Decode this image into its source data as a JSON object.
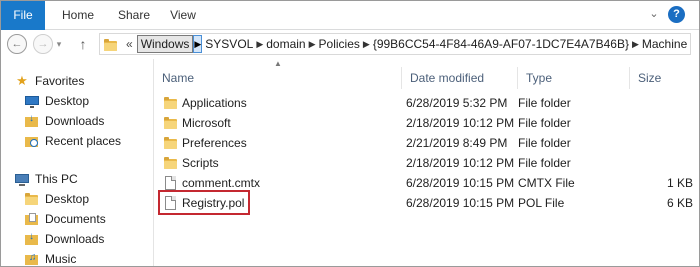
{
  "ribbon": {
    "tabs": [
      "File",
      "Home",
      "Share",
      "View"
    ],
    "expand_icon": "chevron-down-icon",
    "help_glyph": "?"
  },
  "address_bar": {
    "overflow": "«",
    "breadcrumbs": [
      "Windows",
      "SYSVOL",
      "domain",
      "Policies",
      "{99B6CC54-4F84-46A9-AF07-1DC7E4A7B46B}",
      "Machine"
    ]
  },
  "navigation": {
    "favorites_label": "Favorites",
    "favorites": [
      "Desktop",
      "Downloads",
      "Recent places"
    ],
    "this_pc_label": "This PC",
    "this_pc": [
      "Desktop",
      "Documents",
      "Downloads",
      "Music"
    ]
  },
  "file_list": {
    "columns": [
      "Name",
      "Date modified",
      "Type",
      "Size"
    ],
    "rows": [
      {
        "name": "Applications",
        "date": "6/28/2019 5:32 PM",
        "type": "File folder",
        "size": "",
        "icon": "folder-icon"
      },
      {
        "name": "Microsoft",
        "date": "2/18/2019 10:12 PM",
        "type": "File folder",
        "size": "",
        "icon": "folder-icon"
      },
      {
        "name": "Preferences",
        "date": "2/21/2019 8:49 PM",
        "type": "File folder",
        "size": "",
        "icon": "folder-icon"
      },
      {
        "name": "Scripts",
        "date": "2/18/2019 10:12 PM",
        "type": "File folder",
        "size": "",
        "icon": "folder-icon"
      },
      {
        "name": "comment.cmtx",
        "date": "6/28/2019 10:15 PM",
        "type": "CMTX File",
        "size": "1 KB",
        "icon": "file-icon"
      },
      {
        "name": "Registry.pol",
        "date": "6/28/2019 10:15 PM",
        "type": "POL File",
        "size": "6 KB",
        "icon": "file-icon",
        "highlighted": true
      }
    ]
  },
  "colors": {
    "file_tab": "#1979ca",
    "highlight_border": "#c42830",
    "header_text": "#4c607a",
    "folder": "#e9b94a"
  }
}
